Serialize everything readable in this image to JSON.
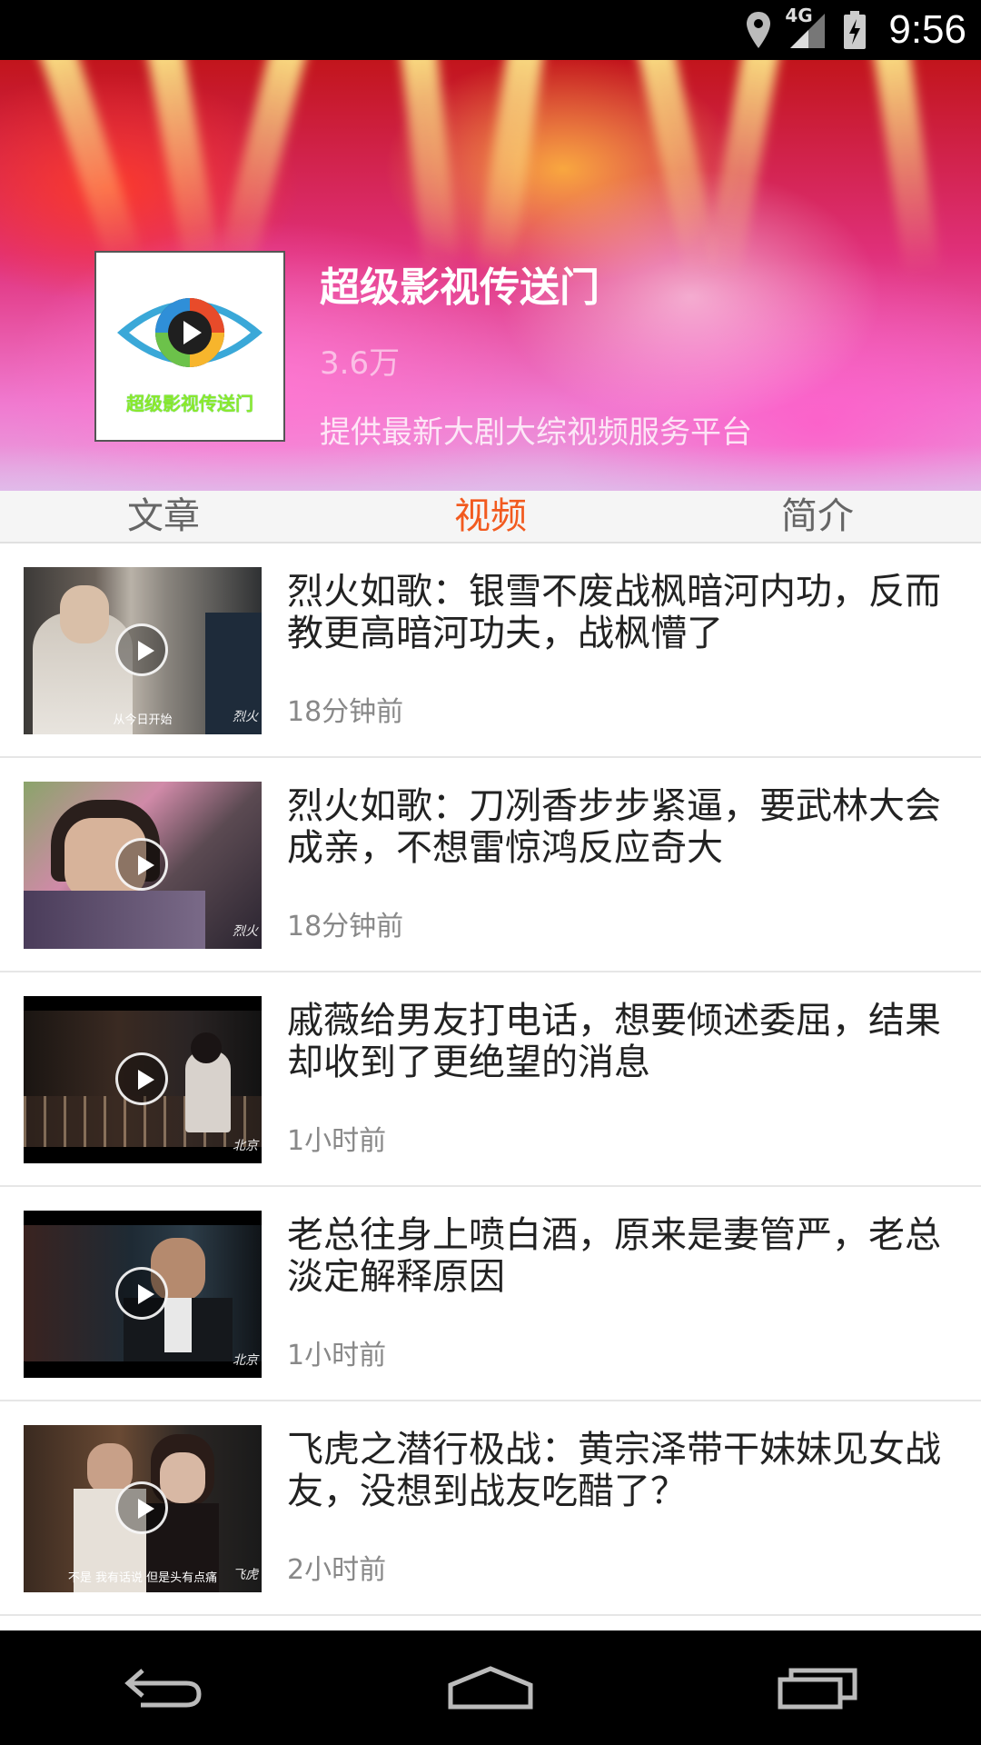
{
  "status_bar": {
    "network": "4G",
    "time": "9:56",
    "icons": [
      "location-icon",
      "signal-icon",
      "battery-charging-icon"
    ]
  },
  "channel": {
    "logo_text": "超级影视传送门",
    "name": "超级影视传送门",
    "followers": "3.6万",
    "description": "提供最新大剧大综视频服务平台"
  },
  "tabs": [
    {
      "label": "文章",
      "active": false
    },
    {
      "label": "视频",
      "active": true
    },
    {
      "label": "简介",
      "active": false
    }
  ],
  "accent_color": "#f25a1f",
  "videos": [
    {
      "title": "烈火如歌：银雪不废战枫暗河内功，反而教更高暗河功夫，战枫懵了",
      "time_ago": "18分钟前",
      "subtitle": "从今日开始"
    },
    {
      "title": "烈火如歌：刀冽香步步紧逼，要武林大会成亲，不想雷惊鸿反应奇大",
      "time_ago": "18分钟前",
      "subtitle": ""
    },
    {
      "title": "戚薇给男友打电话，想要倾述委屈，结果却收到了更绝望的消息",
      "time_ago": "1小时前",
      "subtitle": ""
    },
    {
      "title": "老总往身上喷白酒，原来是妻管严，老总淡定解释原因",
      "time_ago": "1小时前",
      "subtitle": ""
    },
    {
      "title": "飞虎之潜行极战：黄宗泽带干妹妹见女战友，没想到战友吃醋了？",
      "time_ago": "2小时前",
      "subtitle": "不是 我有话说 但是头有点痛"
    }
  ],
  "nav_bar": {
    "icons": [
      "back-icon",
      "home-icon",
      "recents-icon"
    ]
  }
}
